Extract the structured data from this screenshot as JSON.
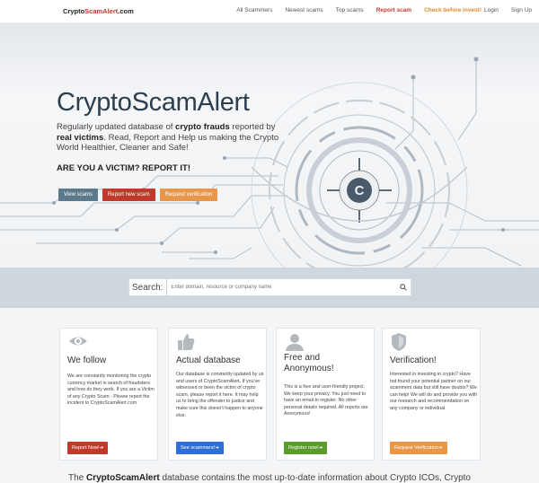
{
  "nav": {
    "logo_main": "Crypto",
    "logo_accent": "ScamAlert",
    "logo_suffix": ".com",
    "links": [
      {
        "label": "All Scammers"
      },
      {
        "label": "Newest scams"
      },
      {
        "label": "Top scams"
      },
      {
        "label": "Report scam"
      },
      {
        "label": "Check before invest!"
      }
    ],
    "login": "Login",
    "signup": "Sign Up"
  },
  "hero": {
    "title": "CryptoScamAlert",
    "desc_1": "Regularly updated database of ",
    "desc_b1": "crypto frauds",
    "desc_2": " reported by ",
    "desc_b2": "real victims",
    "desc_3": ". Read, Report and Help us making the Crypto World Healthier, Cleaner and Safe!",
    "cta": "ARE YOU A VICTIM? REPORT IT!",
    "buttons": {
      "view": "View scams",
      "report": "Report new scam",
      "verify": "Request verification"
    }
  },
  "search": {
    "label": "Search:",
    "placeholder": "Enter domain, resource or company name"
  },
  "cards": [
    {
      "icon": "eye-icon",
      "title": "We follow",
      "text": "We are constantly monitoring the crypto currency market in search of fraudsters and how do they work. If you are a Victim of any Crypto Scam - Please report the incident to CryptoScamAlert.com",
      "button": "Report Now!",
      "arrow": "➔"
    },
    {
      "icon": "thumbs-up-icon",
      "title": "Actual database",
      "text": "Our database is constantly updated by us and users of CryptoScamAlert. If you've witnessed or been the victim of crypto scam, please report it here. It may help us to bring the offender to justice and make sure this doesn't happen to anyone else.",
      "button": "See scammers!",
      "arrow": "➔"
    },
    {
      "icon": "user-icon",
      "title": "Free and Anonymous!",
      "text": "This is a free and user-friendly project. We keep your privacy. You just need to have an email to register. No other personal details required. All reports are Anonymous!",
      "button": "Register now!",
      "arrow": "➔"
    },
    {
      "icon": "shield-icon",
      "title": "Verification!",
      "text": "Interested in investing in crypto? Have not found your potential partner on our scammers data but still have doubts? We can help! We will do and provide you with our research and recommendation on any company or individual.",
      "button": "Request Verification",
      "arrow": "➔"
    }
  ],
  "bottom": {
    "pre": "The ",
    "brand": "CryptoScamAlert",
    "post": " database contains the most up-to-date information about Crypto ICOs, Crypto"
  }
}
